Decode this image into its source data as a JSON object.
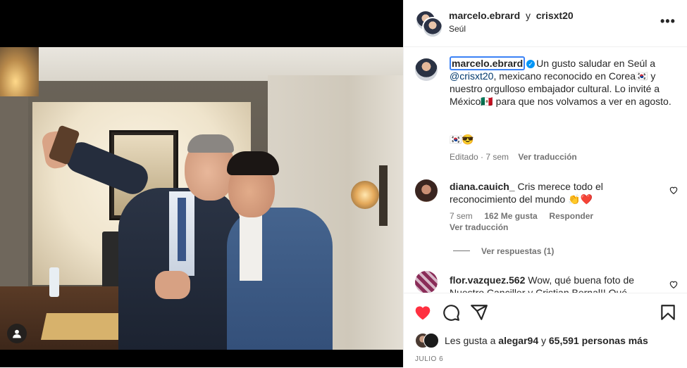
{
  "header": {
    "author": "marcelo.ebrard",
    "conjunction": "y",
    "collaborator": "crisxt20",
    "location": "Seúl",
    "more_icon": "more-horizontal-icon"
  },
  "post": {
    "username": "marcelo.ebrard",
    "verified_mark": "✓",
    "caption_part1": "Un gusto saludar en Seúl a ",
    "caption_mention": "@crisxt20",
    "caption_part2": ", mexicano reconocido en Corea🇰🇷 y nuestro orgulloso embajador cultural. Lo invité a México🇲🇽 para que nos volvamos a ver en agosto.",
    "emoji_line": "🇰🇷😎",
    "edited": "Editado · 7 sem",
    "translate": "Ver traducción"
  },
  "comments": [
    {
      "username": "diana.cauich_",
      "text": "Cris merece todo el reconocimiento del mundo 👏❤️",
      "age": "7 sem",
      "likes": "162 Me gusta",
      "reply": "Responder",
      "translate": "Ver traducción",
      "view_replies": "Ver respuestas (1)"
    },
    {
      "username": "flor.vazquez.562",
      "text": "Wow, qué buena foto de Nuestro Canciller y Cristian Bernal!! Qué"
    }
  ],
  "actions": {
    "like_icon": "heart-filled-icon",
    "comment_icon": "comment-icon",
    "share_icon": "send-icon",
    "save_icon": "bookmark-icon"
  },
  "likes": {
    "prefix": "Les gusta a ",
    "user": "alegar94",
    "middle": " y ",
    "count": "65,591 personas más"
  },
  "date": "JULIO 6",
  "colors": {
    "like_red": "#ff3040",
    "link_blue": "#00376b",
    "verified_blue": "#0095f6",
    "focus_outline": "#3b82f6"
  }
}
